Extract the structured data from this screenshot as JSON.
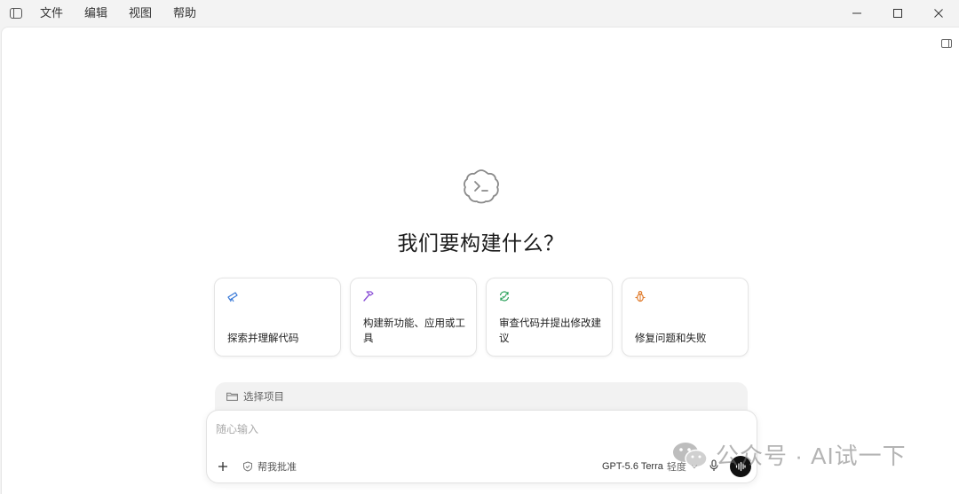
{
  "menu": {
    "items": [
      {
        "label": "文件"
      },
      {
        "label": "编辑"
      },
      {
        "label": "视图"
      },
      {
        "label": "帮助"
      }
    ]
  },
  "main": {
    "headline": "我们要构建什么？",
    "cards": [
      {
        "label": "探索并理解代码",
        "icon": "telescope-icon",
        "color": "#3b7bd8"
      },
      {
        "label": "构建新功能、应用或工具",
        "icon": "hammer-icon",
        "color": "#8a4fd6"
      },
      {
        "label": "审查代码并提出修改建议",
        "icon": "refresh-check-icon",
        "color": "#2aa15a"
      },
      {
        "label": "修复问题和失败",
        "icon": "bug-icon",
        "color": "#e07a2a"
      }
    ],
    "project": {
      "label": "选择项目"
    },
    "composer": {
      "placeholder": "随心输入",
      "approval_label": "帮我批准",
      "model_name": "GPT-5.6 Terra",
      "model_effort": "轻度"
    }
  },
  "watermark": {
    "text": "公众号 · AI试一下"
  }
}
